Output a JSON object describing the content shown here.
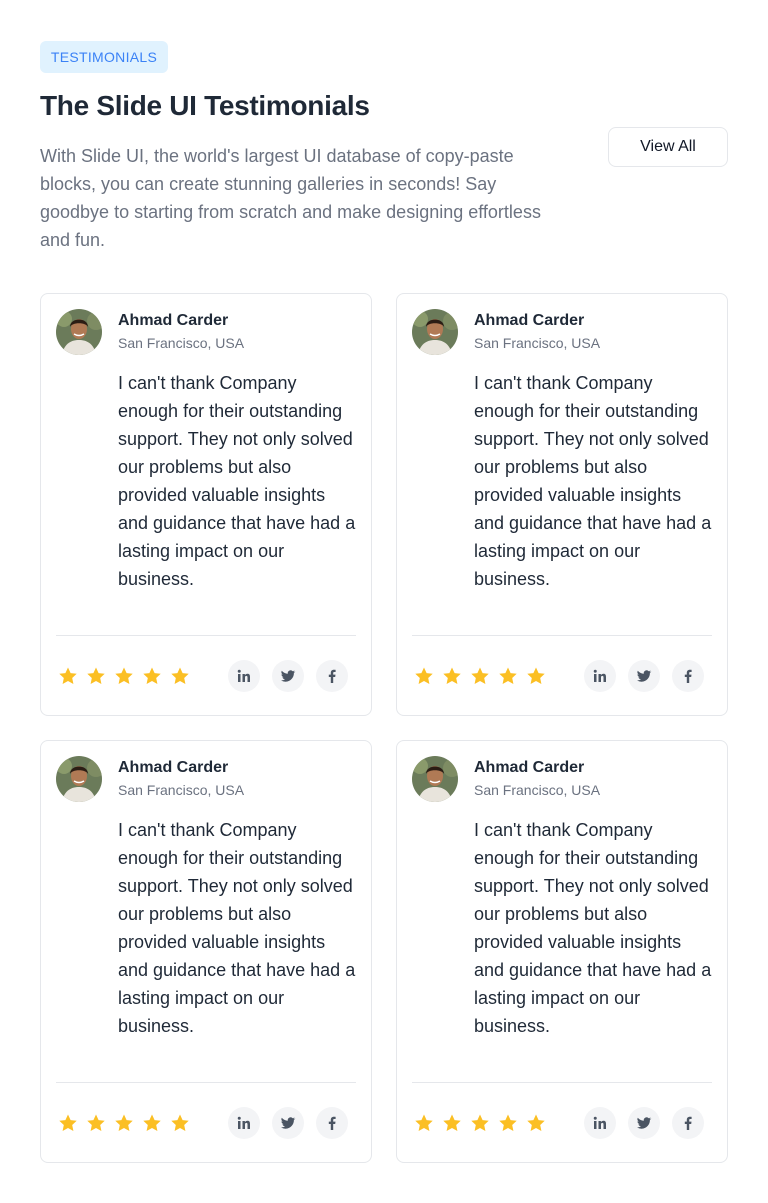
{
  "header": {
    "badge": "TESTIMONIALS",
    "title": "The Slide UI Testimonials",
    "description": "With Slide UI, the world's largest UI database of copy-paste blocks, you can create stunning galleries in seconds! Say goodbye to starting from scratch and make designing effortless and fun.",
    "view_all_label": "View All"
  },
  "colors": {
    "accent": "#3b82f6",
    "badge_bg": "#e0f2fe",
    "star": "#fbbf24",
    "muted": "#6b7280"
  },
  "testimonials": [
    {
      "name": "Ahmad Carder",
      "location": "San Francisco, USA",
      "quote": "I can't thank Company enough for their outstanding support. They not only solved our problems but also provided valuable insights and guidance that have had a lasting impact on our business.",
      "rating": 5,
      "socials": [
        "linkedin-icon",
        "twitter-icon",
        "facebook-icon"
      ]
    },
    {
      "name": "Ahmad Carder",
      "location": "San Francisco, USA",
      "quote": "I can't thank Company enough for their outstanding support. They not only solved our problems but also provided valuable insights and guidance that have had a lasting impact on our business.",
      "rating": 5,
      "socials": [
        "linkedin-icon",
        "twitter-icon",
        "facebook-icon"
      ]
    },
    {
      "name": "Ahmad Carder",
      "location": "San Francisco, USA",
      "quote": "I can't thank Company enough for their outstanding support. They not only solved our problems but also provided valuable insights and guidance that have had a lasting impact on our business.",
      "rating": 5,
      "socials": [
        "linkedin-icon",
        "twitter-icon",
        "facebook-icon"
      ]
    },
    {
      "name": "Ahmad Carder",
      "location": "San Francisco, USA",
      "quote": "I can't thank Company enough for their outstanding support. They not only solved our problems but also provided valuable insights and guidance that have had a lasting impact on our business.",
      "rating": 5,
      "socials": [
        "linkedin-icon",
        "twitter-icon",
        "facebook-icon"
      ]
    }
  ]
}
